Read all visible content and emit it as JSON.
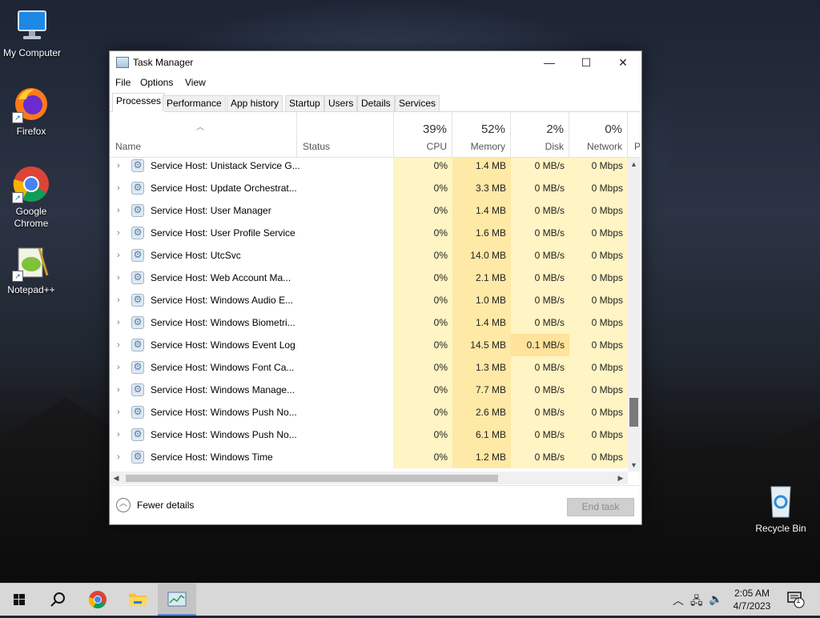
{
  "desktop": {
    "icons": [
      {
        "label": "My Computer"
      },
      {
        "label": "Firefox"
      },
      {
        "label": "Google Chrome"
      },
      {
        "label": "Notepad++"
      },
      {
        "label": "Recycle Bin"
      }
    ]
  },
  "window": {
    "title": "Task Manager",
    "controls": {
      "minimize": "—",
      "maximize": "☐",
      "close": "✕"
    },
    "menu": [
      "File",
      "Options",
      "View"
    ],
    "tabs": [
      "Processes",
      "Performance",
      "App history",
      "Startup",
      "Users",
      "Details",
      "Services"
    ],
    "active_tab": "Processes"
  },
  "table": {
    "columns": {
      "name": "Name",
      "status": "Status",
      "cpu": {
        "label": "CPU",
        "pct": "39%"
      },
      "memory": {
        "label": "Memory",
        "pct": "52%"
      },
      "disk": {
        "label": "Disk",
        "pct": "2%"
      },
      "network": {
        "label": "Network",
        "pct": "0%"
      },
      "overflow": "P"
    },
    "rows": [
      {
        "name": "Service Host: Unistack Service G...",
        "cpu": "0%",
        "memory": "1.4 MB",
        "disk": "0 MB/s",
        "network": "0 Mbps"
      },
      {
        "name": "Service Host: Update Orchestrat...",
        "cpu": "0%",
        "memory": "3.3 MB",
        "disk": "0 MB/s",
        "network": "0 Mbps"
      },
      {
        "name": "Service Host: User Manager",
        "cpu": "0%",
        "memory": "1.4 MB",
        "disk": "0 MB/s",
        "network": "0 Mbps"
      },
      {
        "name": "Service Host: User Profile Service",
        "cpu": "0%",
        "memory": "1.6 MB",
        "disk": "0 MB/s",
        "network": "0 Mbps"
      },
      {
        "name": "Service Host: UtcSvc",
        "cpu": "0%",
        "memory": "14.0 MB",
        "disk": "0 MB/s",
        "network": "0 Mbps"
      },
      {
        "name": "Service Host: Web Account Ma...",
        "cpu": "0%",
        "memory": "2.1 MB",
        "disk": "0 MB/s",
        "network": "0 Mbps"
      },
      {
        "name": "Service Host: Windows Audio E...",
        "cpu": "0%",
        "memory": "1.0 MB",
        "disk": "0 MB/s",
        "network": "0 Mbps"
      },
      {
        "name": "Service Host: Windows Biometri...",
        "cpu": "0%",
        "memory": "1.4 MB",
        "disk": "0 MB/s",
        "network": "0 Mbps"
      },
      {
        "name": "Service Host: Windows Event Log",
        "cpu": "0%",
        "memory": "14.5 MB",
        "disk": "0.1 MB/s",
        "network": "0 Mbps"
      },
      {
        "name": "Service Host: Windows Font Ca...",
        "cpu": "0%",
        "memory": "1.3 MB",
        "disk": "0 MB/s",
        "network": "0 Mbps"
      },
      {
        "name": "Service Host: Windows Manage...",
        "cpu": "0%",
        "memory": "7.7 MB",
        "disk": "0 MB/s",
        "network": "0 Mbps"
      },
      {
        "name": "Service Host: Windows Push No...",
        "cpu": "0%",
        "memory": "2.6 MB",
        "disk": "0 MB/s",
        "network": "0 Mbps"
      },
      {
        "name": "Service Host: Windows Push No...",
        "cpu": "0%",
        "memory": "6.1 MB",
        "disk": "0 MB/s",
        "network": "0 Mbps"
      },
      {
        "name": "Service Host: Windows Time",
        "cpu": "0%",
        "memory": "1.2 MB",
        "disk": "0 MB/s",
        "network": "0 Mbps"
      }
    ]
  },
  "footer": {
    "fewer_details": "Fewer details",
    "end_task": "End task"
  },
  "taskbar": {
    "time": "2:05 AM",
    "date": "4/7/2023",
    "notification_count": "1"
  },
  "colors": {
    "cpu_column": "#fff4c4",
    "memory_column": "#ffe9a6",
    "highlight_disk": "#ffe39a",
    "taskbar": "#d8d8d8"
  }
}
